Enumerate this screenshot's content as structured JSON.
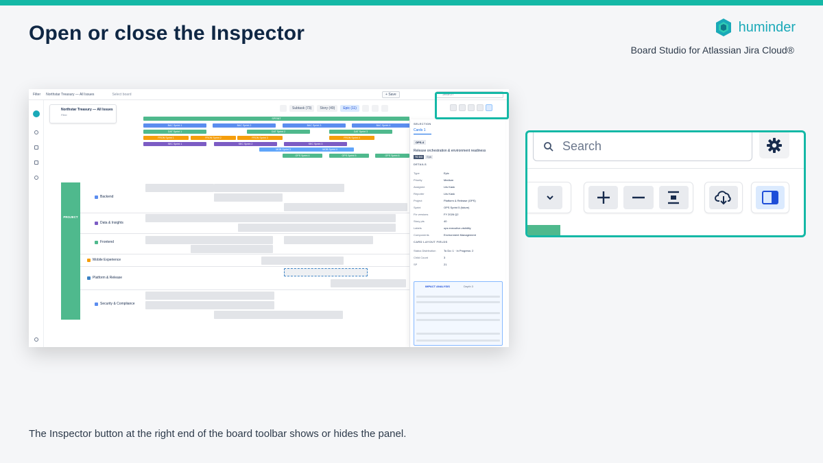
{
  "slide": {
    "title": "Open or close the Inspector",
    "brand_name": "huminder",
    "subtitle": "Board Studio for Atlassian Jira Cloud®",
    "caption": "The Inspector button at the right end of the board toolbar shows or hides the panel."
  },
  "screenshot": {
    "topbar": {
      "filter": "Filter",
      "board": "Northstar Treasury — All Issues",
      "select_board": "Select board",
      "save": "Save",
      "search_placeholder": "Search"
    },
    "filter_card": {
      "title": "Northstar Treasury — All Issues",
      "sub": "Filter"
    },
    "toolbar": {
      "subtask": "Subtask (73)",
      "story": "Story (49)",
      "epic": "Epic (11)"
    },
    "sprint_header": "SPRINT",
    "sprints": [
      {
        "label": "BAC Sprint 1",
        "color": "#5b8def"
      },
      {
        "label": "BAC Sprint 2",
        "color": "#5b8def"
      },
      {
        "label": "BAC Sprint 3",
        "color": "#5b8def"
      },
      {
        "label": "BAC Sprint 4",
        "color": "#5b8def"
      },
      {
        "label": "DAT Sprint 1",
        "color": "#4fb98d"
      },
      {
        "label": "DAT Sprint 2",
        "color": "#4fb98d"
      },
      {
        "label": "DAT Sprint 3",
        "color": "#4fb98d"
      },
      {
        "label": "FRON Sprint 1",
        "color": "#f59e0b"
      },
      {
        "label": "FRON Sprint 2",
        "color": "#f59e0b"
      },
      {
        "label": "FRON Sprint 3",
        "color": "#f59e0b"
      },
      {
        "label": "FRON Sprint 4",
        "color": "#f59e0b"
      },
      {
        "label": "SEC Sprint 1",
        "color": "#7c5cc4"
      },
      {
        "label": "SEC Sprint 2",
        "color": "#7c5cc4"
      },
      {
        "label": "SEC Sprint 3",
        "color": "#7c5cc4"
      },
      {
        "label": "MOB Sprint 3",
        "color": "#60a5fa"
      },
      {
        "label": "MOB Sprint 4",
        "color": "#60a5fa"
      },
      {
        "label": "OPS Sprint 4",
        "color": "#4fb98d"
      },
      {
        "label": "OPS Sprint 5",
        "color": "#4fb98d"
      },
      {
        "label": "OPS Sprint 6",
        "color": "#4fb98d"
      }
    ],
    "swimlane": "PROJECT",
    "rows": [
      {
        "label": "Backend",
        "color": "#5b8def"
      },
      {
        "label": "Data & Insights",
        "color": "#7c5cc4"
      },
      {
        "label": "Frontend",
        "color": "#4fb98d"
      },
      {
        "label": "Mobile Experience",
        "color": "#f59e0b"
      },
      {
        "label": "Platform & Release",
        "color": "#3b82c4"
      },
      {
        "label": "Security & Compliance",
        "color": "#5b8def"
      }
    ],
    "inspector": {
      "heading": "SELECTION",
      "tab": "Cards",
      "tab_count": "1",
      "key": "OPS-4",
      "title": "Release orchestration & environment readiness",
      "status": "TO DO",
      "type_chip": "Epic",
      "details_heading": "DETAILS",
      "fields": [
        {
          "k": "Type",
          "v": "Epic"
        },
        {
          "k": "Priority",
          "v": "Medium"
        },
        {
          "k": "Assignee",
          "v": "Liis Kask"
        },
        {
          "k": "Reporter",
          "v": "Liis Kask"
        },
        {
          "k": "Project",
          "v": "Platform & Release (OPS)"
        },
        {
          "k": "Sprint",
          "v": "OPS Sprint 5 (future)"
        },
        {
          "k": "Fix versions",
          "v": "FY 2026 Q2"
        },
        {
          "k": "Story pts",
          "v": "40"
        },
        {
          "k": "Labels",
          "v": "ops  executive-visibility"
        },
        {
          "k": "Components",
          "v": "Environment Management"
        }
      ],
      "card_layout_heading": "CARD LAYOUT FIELDS",
      "layout_fields": [
        {
          "k": "Status Distribution",
          "v": "To Do: 1 · In Progress: 2"
        },
        {
          "k": "Child Count",
          "v": "3"
        },
        {
          "k": "SP",
          "v": "21"
        }
      ],
      "impact_title": "IMPACT ANALYSIS",
      "impact_depth": "Depth 3"
    }
  },
  "zoom": {
    "search_placeholder": "Search"
  },
  "colors": {
    "accent": "#14b8a6",
    "brand": "#1aa9b8",
    "title": "#0f2744"
  }
}
